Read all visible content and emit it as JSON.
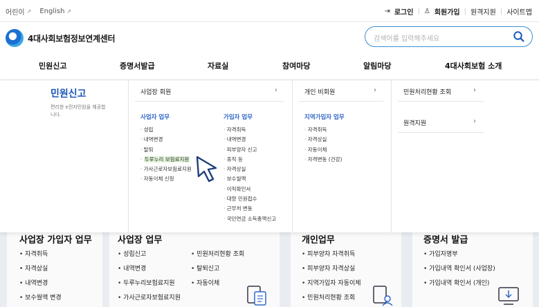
{
  "utility": {
    "kids": "어린이",
    "english": "English",
    "login": "로그인",
    "signup": "회원가입",
    "remote": "원격지원",
    "sitemap": "사이트맵"
  },
  "header": {
    "logo_text": "4대사회보험정보연계센터",
    "search_placeholder": "검색어를 입력해주세요"
  },
  "nav": [
    "민원신고",
    "증명서발급",
    "자료실",
    "참여마당",
    "알림마당",
    "4대사회보험 소개"
  ],
  "mega": {
    "title": "민원신고",
    "desc": "편리한 e전자민원을 체공합니다.",
    "col1": {
      "header": "사업장 회원",
      "sub1": {
        "title": "사업자 업무",
        "items": [
          "성립",
          "내역변경",
          "탈퇴",
          "두루누리 보험료지원",
          "가사근로자보험료지원",
          "자동이체 신청"
        ]
      },
      "sub2": {
        "title": "가입자 업무",
        "items": [
          "자격취득",
          "내역변경",
          "피부양자 신고",
          "휴직 등",
          "자격상실",
          "보수월액",
          "이직확인서",
          "대량 민원접수",
          "근무처 변동",
          "국민연금 소득총액신고"
        ]
      }
    },
    "col2": {
      "header": "개인 비회원",
      "sub": {
        "title": "지역가입자 업무",
        "items": [
          "자격취득",
          "자격상실",
          "자동이체",
          "자격변동 (건강)"
        ]
      }
    },
    "col3": {
      "items": [
        "민원처리현황 조회",
        "원격지원"
      ]
    }
  },
  "bottom": {
    "card1": {
      "title": "사업장 가입자 업무",
      "items": [
        "자격취득",
        "자격상실",
        "내역변경",
        "보수월액 변경"
      ]
    },
    "card2": {
      "title": "사업장 업무",
      "items_a": [
        "성립신고",
        "내역변경",
        "두루누리보험료지원",
        "가사근로자보험료지원"
      ],
      "items_b": [
        "민원처리현황 조회",
        "탈퇴신고",
        "자동이체"
      ]
    },
    "card3": {
      "title": "개인업무",
      "items": [
        "피부양자 자격취득",
        "피부양자 자격상실",
        "지역가입자 자동이체",
        "민원처리현황 조회"
      ]
    },
    "card4": {
      "title": "증명서 발급",
      "items": [
        "가입자명부",
        "가입내역 확인서 (사업장)",
        "가입내역 확인서 (개인)"
      ]
    }
  },
  "colors": {
    "accent": "#1a57b8",
    "submenu_blue": "#2e66c7",
    "search_border": "#3a8fd4",
    "highlight": "#e2f4d8"
  }
}
